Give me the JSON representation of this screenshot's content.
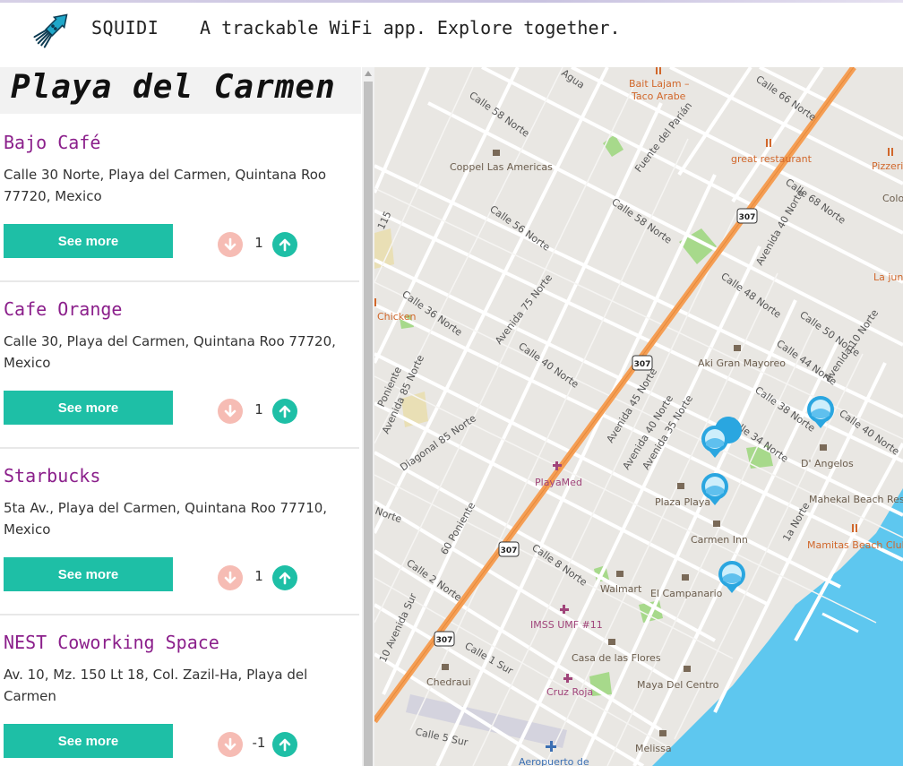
{
  "header": {
    "brand": "SQUIDI",
    "tagline": "A trackable WiFi app. Explore together."
  },
  "sidebar": {
    "city": "Playa del Carmen",
    "places": [
      {
        "name": "Bajo Café",
        "address": "Calle 30 Norte, Playa del Carmen, Quintana Roo 77720, Mexico",
        "button": "See more",
        "votes": "1"
      },
      {
        "name": "Cafe Orange",
        "address": "Calle 30, Playa del Carmen, Quintana Roo 77720, Mexico",
        "button": "See more",
        "votes": "1"
      },
      {
        "name": "Starbucks",
        "address": "5ta Av., Playa del Carmen, Quintana Roo 77710, Mexico",
        "button": "See more",
        "votes": "1"
      },
      {
        "name": "NEST Coworking Space",
        "address": "Av. 10, Mz. 150 Lt 18, Col. Zazil-Ha, Playa del Carmen",
        "button": "See more",
        "votes": "-1"
      }
    ]
  },
  "map": {
    "streets": [
      "Calle 58 Norte",
      "Calle 56 Norte",
      "Calle 36 Norte",
      "Avenida 75 Norte",
      "Calle 40 Norte",
      "Diagonal 85 Norte",
      "Avenida 85 Norte",
      "Calle 66 Norte",
      "Calle 68 Norte",
      "Avenida 40 Norte",
      "Calle 48 Norte",
      "Calle 50 Norte",
      "Calle 44 Norte",
      "Avenida 10 Norte",
      "Calle 38 Norte",
      "Calle 34 Norte",
      "Avenida 45 Norte",
      "Avenida 35 Norte",
      "Calle 8 Norte",
      "Calle 2 Norte",
      "60 Poniente",
      "Calle 1 Sur",
      "Calle 5 Sur",
      "10 Avenida Sur",
      "1a Norte",
      "Fuente del Parián",
      "Agua",
      "115",
      "Norte",
      "Poniente"
    ],
    "highway_shield": "307",
    "pois": [
      "Bait Lajam – Taco Arabe",
      "great restaurant",
      "Pizzeri",
      "Colo",
      "La jung",
      "Coppel Las Americas",
      "Chicken",
      "Aki Gran Mayoreo",
      "D' Angelos",
      "Mahekal Beach Reso",
      "Mamitas Beach Club",
      "PlayaMed",
      "Plaza Playa",
      "Carmen Inn",
      "Walmart",
      "El Campanario",
      "IMSS UMF #11",
      "Casa de las Flores",
      "Chedraui",
      "Cruz Roja",
      "Maya Del Centro",
      "Melissa",
      "Aeropuerto de"
    ],
    "wifi_markers": 4,
    "colors": {
      "highway": "#f59e54",
      "sea": "#5ec7ef",
      "park": "#a7d98b",
      "accent": "#1ebfa6",
      "name": "#8b1f8b"
    }
  }
}
